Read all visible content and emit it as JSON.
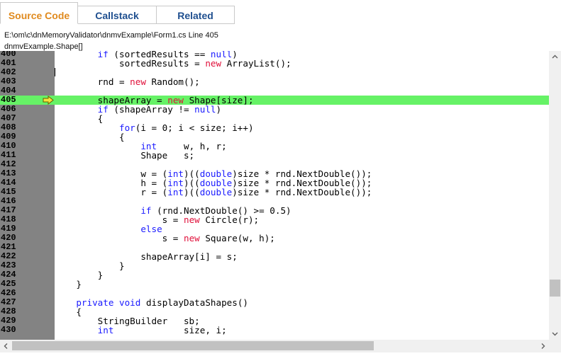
{
  "tabs": [
    {
      "label": "Source Code",
      "active": true
    },
    {
      "label": "Callstack",
      "active": false
    },
    {
      "label": "Related",
      "active": false
    }
  ],
  "file_info": {
    "path_line": "E:\\om\\c\\dnMemoryValidator\\dnmvExample\\Form1.cs Line 405",
    "symbol": "dnmvExample.Shape[]"
  },
  "editor": {
    "current_line": "405",
    "lines": [
      {
        "n": "400",
        "t": "        if (sortedResults == null)"
      },
      {
        "n": "401",
        "t": "            sortedResults = new ArrayList();"
      },
      {
        "n": "402",
        "t": ""
      },
      {
        "n": "403",
        "t": "        rnd = new Random();"
      },
      {
        "n": "404",
        "t": ""
      },
      {
        "n": "405",
        "t": "        shapeArray = new Shape[size];"
      },
      {
        "n": "406",
        "t": "        if (shapeArray != null)"
      },
      {
        "n": "407",
        "t": "        {"
      },
      {
        "n": "408",
        "t": "            for(i = 0; i < size; i++)"
      },
      {
        "n": "409",
        "t": "            {"
      },
      {
        "n": "410",
        "t": "                int     w, h, r;"
      },
      {
        "n": "411",
        "t": "                Shape   s;"
      },
      {
        "n": "412",
        "t": ""
      },
      {
        "n": "413",
        "t": "                w = (int)((double)size * rnd.NextDouble());"
      },
      {
        "n": "414",
        "t": "                h = (int)((double)size * rnd.NextDouble());"
      },
      {
        "n": "415",
        "t": "                r = (int)((double)size * rnd.NextDouble());"
      },
      {
        "n": "416",
        "t": ""
      },
      {
        "n": "417",
        "t": "                if (rnd.NextDouble() >= 0.5)"
      },
      {
        "n": "418",
        "t": "                    s = new Circle(r);"
      },
      {
        "n": "419",
        "t": "                else"
      },
      {
        "n": "420",
        "t": "                    s = new Square(w, h);"
      },
      {
        "n": "421",
        "t": ""
      },
      {
        "n": "422",
        "t": "                shapeArray[i] = s;"
      },
      {
        "n": "423",
        "t": "            }"
      },
      {
        "n": "424",
        "t": "        }"
      },
      {
        "n": "425",
        "t": "    }"
      },
      {
        "n": "426",
        "t": ""
      },
      {
        "n": "427",
        "t": "    private void displayDataShapes()"
      },
      {
        "n": "428",
        "t": "    {"
      },
      {
        "n": "429",
        "t": "        StringBuilder   sb;"
      },
      {
        "n": "430",
        "t": "        int             size, i;"
      }
    ],
    "keywords": [
      "if",
      "else",
      "for",
      "int",
      "double",
      "null",
      "private",
      "void"
    ],
    "new_keyword": "new"
  },
  "colors": {
    "active_tab": "#e08a1e",
    "tab_text": "#1f4f8f",
    "keyword": "#1a1aff",
    "new_keyword": "#e0103a",
    "highlight": "#66f266",
    "gutter": "#838383"
  },
  "icons": {
    "execution_arrow": "yellow-arrow-icon",
    "scroll_up": "chevron-up-icon",
    "scroll_down": "chevron-down-icon",
    "scroll_left": "chevron-left-icon",
    "scroll_right": "chevron-right-icon"
  }
}
